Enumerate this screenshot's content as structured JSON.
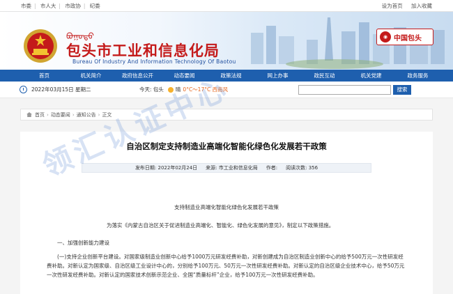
{
  "topbar": {
    "links": [
      "市委",
      "市人大",
      "市政协",
      "纪委"
    ],
    "homepage_label": "设为首页",
    "favorite_label": "加入收藏"
  },
  "header": {
    "title_mongol": "ᠪᠤᠭᠤᠲᠤ",
    "title_zh": "包头市工业和信息化局",
    "title_en": "Bureau Of Industry And Information Technology  Of Baotou",
    "badge_text": "中国包头"
  },
  "nav": {
    "items": [
      "首页",
      "机关简介",
      "政府信息公开",
      "动态要闻",
      "政策法规",
      "网上办事",
      "政民互动",
      "机关党建",
      "政务服务"
    ]
  },
  "info": {
    "date": "2022年03月15日 星期二",
    "weather_label": "今天: 包头",
    "weather_temp": "0°C～17°C 西南风",
    "weather_extra": "晴",
    "search_placeholder": "",
    "search_button": "搜索"
  },
  "breadcrumb": {
    "items": [
      "首页",
      "动态要闻",
      "通知公告",
      "正文"
    ]
  },
  "article": {
    "title": "自治区制定支持制造业高端化智能化绿色化发展若干政策",
    "publish_label": "发布日期: 2022年02月24日",
    "source_label": "来源: 市工业和信息化局",
    "author_label": "作者:",
    "views_label": "阅读次数: 356",
    "subhead": "支持制造业高端化智能化绿色化发展若干政策",
    "intro": "为落实《内蒙古自治区关于促进制造业高端化、智能化、绿色化发展的意见》，制定以下政策措施。",
    "section1": "一、加强创新能力建设",
    "para1": "(一)支持企业创新平台建设。对国家级制造业创新中心给予1000万元研发经费补助，对新创建成为自治区制造业创新中心的给予500万元一次性研发经费补助。对新认定为国家级、自治区级工业设计中心的，分别给予100万元、50万元一次性研发经费补助。对新认定的自治区级企业技术中心，给予50万元一次性研发经费补助。对新认定的国家技术创新示范企业、全国“质量标杆”企业，给予100万元一次性研发经费补助。"
  },
  "watermark": "领汇认证中心",
  "colors": {
    "nav_blue": "#1e5fae",
    "title_red": "#c41a1a"
  }
}
